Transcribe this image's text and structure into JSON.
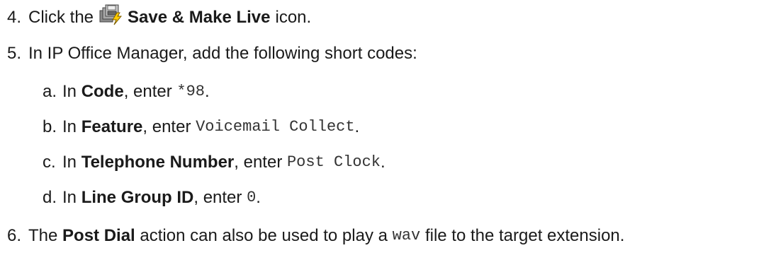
{
  "steps": [
    {
      "num": "4.",
      "before": "Click the",
      "icon": "save-make-live-icon",
      "bold": "Save & Make Live",
      "after": "icon."
    },
    {
      "num": "5.",
      "text": "In IP Office Manager, add the following short codes:"
    },
    {
      "num": "a.",
      "before": "In",
      "bold": "Code",
      "mid": ", enter",
      "code": "*98",
      "after": "."
    },
    {
      "num": "b.",
      "before": "In",
      "bold": "Feature",
      "mid": ", enter",
      "code": "Voicemail Collect",
      "after": "."
    },
    {
      "num": "c.",
      "before": "In",
      "bold": "Telephone Number",
      "mid": ", enter",
      "code": "Post Clock",
      "after": "."
    },
    {
      "num": "d.",
      "before": "In",
      "bold": "Line Group ID",
      "mid": ", enter",
      "code": "0",
      "after": "."
    },
    {
      "num": "6.",
      "before": "The",
      "bold": "Post Dial",
      "mid": "action can also be used to play a",
      "code": "wav",
      "after": "file to the target extension."
    }
  ]
}
